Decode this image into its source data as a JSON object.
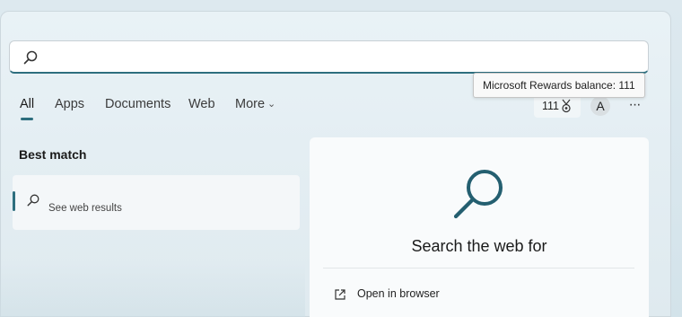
{
  "search": {
    "value": "",
    "placeholder": "",
    "icon": "search-icon"
  },
  "tooltip": {
    "text": "Microsoft Rewards balance: 111"
  },
  "tabs": [
    {
      "label": "All",
      "active": true
    },
    {
      "label": "Apps"
    },
    {
      "label": "Documents"
    },
    {
      "label": "Web"
    },
    {
      "label": "More"
    }
  ],
  "header": {
    "rewards_count": "111",
    "rewards_icon": "rewards-medal-icon",
    "avatar_letter": "A",
    "more_options_glyph": "···"
  },
  "best_match": {
    "heading": "Best match",
    "item_label": "See web results",
    "icon": "search-icon"
  },
  "preview": {
    "title": "Search the web for",
    "open_label": "Open in browser",
    "open_icon": "external-link-icon"
  },
  "colors": {
    "accent": "#2d6e7e"
  }
}
